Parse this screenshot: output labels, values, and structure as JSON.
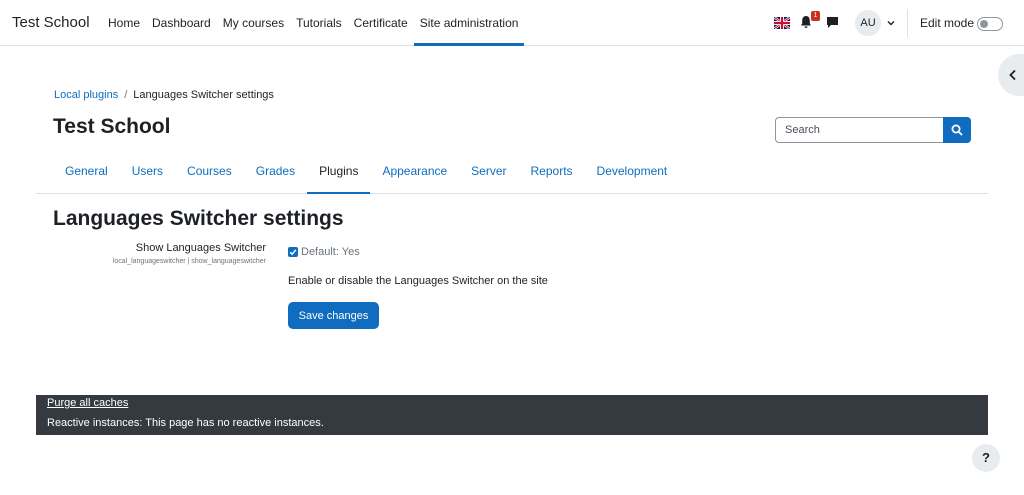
{
  "site": {
    "brand": "Test School"
  },
  "primary_nav": {
    "items": [
      {
        "label": "Home"
      },
      {
        "label": "Dashboard"
      },
      {
        "label": "My courses"
      },
      {
        "label": "Tutorials"
      },
      {
        "label": "Certificate"
      },
      {
        "label": "Site administration",
        "active": true
      }
    ]
  },
  "usermenu": {
    "notification_count": "1",
    "avatar_initials": "AU",
    "edit_mode_label": "Edit mode",
    "edit_mode_on": false,
    "icons": {
      "language": "uk-flag-icon",
      "notifications": "bell-icon",
      "messages": "chat-bubble-icon",
      "drawer": "chevron-left-icon"
    }
  },
  "breadcrumb": {
    "items": [
      {
        "label": "Local plugins"
      },
      {
        "label": "Languages Switcher settings"
      }
    ],
    "separator": "/"
  },
  "header": {
    "title": "Test School"
  },
  "search": {
    "placeholder": "Search"
  },
  "secondary_nav": {
    "items": [
      {
        "label": "General"
      },
      {
        "label": "Users"
      },
      {
        "label": "Courses"
      },
      {
        "label": "Grades"
      },
      {
        "label": "Plugins",
        "active": true
      },
      {
        "label": "Appearance"
      },
      {
        "label": "Server"
      },
      {
        "label": "Reports"
      },
      {
        "label": "Development"
      }
    ]
  },
  "main": {
    "heading": "Languages Switcher settings",
    "setting": {
      "label": "Show Languages Switcher",
      "identifier": "local_languageswitcher | show_languageswitcher",
      "checked": true,
      "default_text": "Default: Yes",
      "description": "Enable or disable the Languages Switcher on the site"
    },
    "save_label": "Save changes"
  },
  "footer": {
    "purge_label": "Purge all caches",
    "reactive_text": "Reactive instances: This page has no reactive instances."
  },
  "help": {
    "label": "?"
  },
  "colors": {
    "primary": "#0f6cbf",
    "footer_bg": "#343a40",
    "badge": "#ca3120"
  }
}
